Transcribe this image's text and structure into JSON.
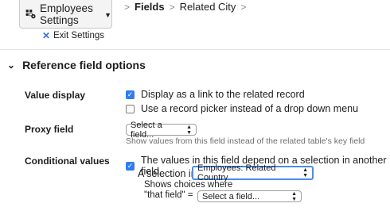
{
  "header": {
    "settings_button": "Employees Settings",
    "exit_settings": "Exit Settings",
    "breadcrumb": [
      "Fields",
      "Related City"
    ]
  },
  "section": {
    "title": "Reference field options"
  },
  "value_display": {
    "label": "Value display",
    "option1": "Display as a link to the related record",
    "option1_checked": true,
    "option2": "Use a record picker instead of a drop down menu",
    "option2_checked": false
  },
  "proxy_field": {
    "label": "Proxy field",
    "select_value": "Select a field...",
    "help": "Show values from this field instead of the related table's key field"
  },
  "conditional_values": {
    "label": "Conditional values",
    "checkbox": "The values in this field depend on a selection in another field",
    "checked": true,
    "selection_in_label": "A selection in",
    "selection_in_value": "Employees: Related Country",
    "shows_choices": "Shows choices where",
    "that_field_label": "\"that field\" =",
    "that_field_value": "Select a field..."
  },
  "colors": {
    "accent": "#2f7df6",
    "help_text": "#6d6d6d"
  }
}
